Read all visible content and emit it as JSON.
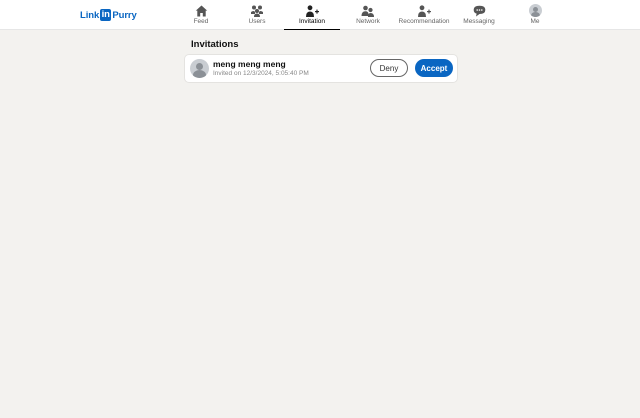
{
  "app": {
    "logo_left": "Link",
    "logo_box": "in",
    "logo_right": "Purry"
  },
  "nav": {
    "items": [
      {
        "label": "Feed",
        "icon": "home-icon"
      },
      {
        "label": "Users",
        "icon": "users-icon"
      },
      {
        "label": "Invitation",
        "icon": "add-person-icon",
        "active": true
      },
      {
        "label": "Network",
        "icon": "network-icon"
      },
      {
        "label": "Recommendation",
        "icon": "recommend-person-icon"
      },
      {
        "label": "Messaging",
        "icon": "chat-icon"
      },
      {
        "label": "Me",
        "icon": "avatar-icon"
      }
    ]
  },
  "main": {
    "title": "Invitations",
    "invitations": [
      {
        "name": "meng meng meng",
        "invited_text": "Invited on 12/3/2024, 5:05:40 PM",
        "deny_label": "Deny",
        "accept_label": "Accept"
      }
    ]
  },
  "colors": {
    "brand": "#0a66c2",
    "background": "#f3f2ef"
  }
}
